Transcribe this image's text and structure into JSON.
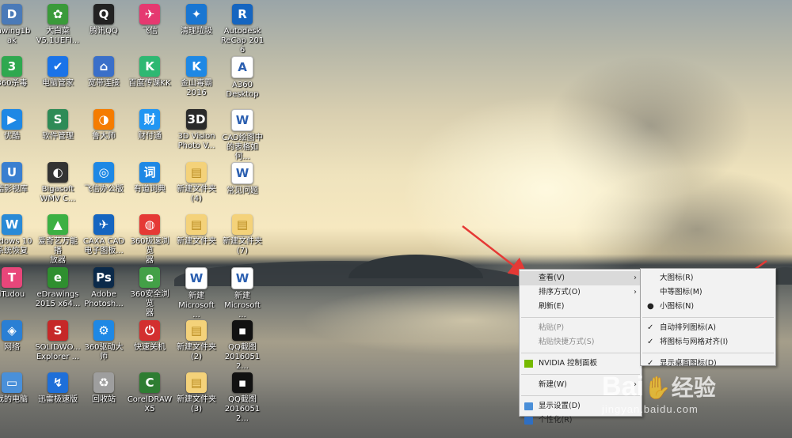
{
  "desktop": {
    "icons": [
      {
        "id": "i01",
        "label": "rawing1b\nak",
        "color": "#4a7ab8",
        "glyph": "D"
      },
      {
        "id": "i02",
        "label": "360杀毒",
        "color": "#2fa84f",
        "glyph": "3"
      },
      {
        "id": "i03",
        "label": "优酷",
        "color": "#1e88e5",
        "glyph": "▶"
      },
      {
        "id": "i04",
        "label": "酷影视库",
        "color": "#3a7fd0",
        "glyph": "U"
      },
      {
        "id": "i05",
        "label": "indows 10\n系统恢复",
        "color": "#2a8ad6",
        "glyph": "W"
      },
      {
        "id": "i06",
        "label": "iTudou",
        "color": "#e8467a",
        "glyph": "T"
      },
      {
        "id": "i07",
        "label": "网络",
        "color": "#2a7fd4",
        "glyph": "◈"
      },
      {
        "id": "i08",
        "label": "我的电脑",
        "color": "#4a90d9",
        "glyph": "▭"
      },
      {
        "id": "i09",
        "label": "大白菜\nV5.1UEFI...",
        "color": "#3a9a3a",
        "glyph": "✿"
      },
      {
        "id": "i10",
        "label": "电脑管家",
        "color": "#1a73e8",
        "glyph": "✔"
      },
      {
        "id": "i11",
        "label": "软件管理",
        "color": "#2e8b57",
        "glyph": "S"
      },
      {
        "id": "i12",
        "label": "Bigasoft\nWMV C...",
        "color": "#333333",
        "glyph": "◐"
      },
      {
        "id": "i13",
        "label": "爱奇艺万能播\n放器",
        "color": "#3cb043",
        "glyph": "▲"
      },
      {
        "id": "i14",
        "label": "eDrawings\n2015 x64...",
        "color": "#2f8f2f",
        "glyph": "e"
      },
      {
        "id": "i15",
        "label": "SOLIDWO...\nExplorer ...",
        "color": "#c62828",
        "glyph": "S"
      },
      {
        "id": "i16",
        "label": "迅雷极速版",
        "color": "#1e6fd9",
        "glyph": "↯"
      },
      {
        "id": "i17",
        "label": "腾讯QQ",
        "color": "#222222",
        "glyph": "Q"
      },
      {
        "id": "i18",
        "label": "宽带连接",
        "color": "#3a6fc9",
        "glyph": "⌂"
      },
      {
        "id": "i19",
        "label": "鲁大师",
        "color": "#f57c00",
        "glyph": "◑"
      },
      {
        "id": "i20",
        "label": "飞信办公版",
        "color": "#1e88e5",
        "glyph": "◎"
      },
      {
        "id": "i21",
        "label": "CAXA CAD\n电子图板...",
        "color": "#1565c0",
        "glyph": "✈"
      },
      {
        "id": "i22",
        "label": "Adobe\nPhotosh...",
        "color": "#0b2a4a",
        "glyph": "Ps"
      },
      {
        "id": "i23",
        "label": "360驱动大师",
        "color": "#1e88e5",
        "glyph": "⚙"
      },
      {
        "id": "i24",
        "label": "回收站",
        "color": "#9e9e9e",
        "glyph": "♻"
      },
      {
        "id": "i25",
        "label": "飞信",
        "color": "#e53970",
        "glyph": "✈"
      },
      {
        "id": "i26",
        "label": "百度传课KK",
        "color": "#2eb872",
        "glyph": "K"
      },
      {
        "id": "i27",
        "label": "财付通",
        "color": "#2196f3",
        "glyph": "财"
      },
      {
        "id": "i28",
        "label": "有道词典",
        "color": "#1e88e5",
        "glyph": "词"
      },
      {
        "id": "i29",
        "label": "360极速浏览\n器",
        "color": "#e53935",
        "glyph": "◍"
      },
      {
        "id": "i30",
        "label": "360安全浏览\n器",
        "color": "#43a047",
        "glyph": "e"
      },
      {
        "id": "i31",
        "label": "快速关机",
        "color": "#d32f2f",
        "glyph": "⏻"
      },
      {
        "id": "i32",
        "label": "CorelDRAW\nX5",
        "color": "#2e7d32",
        "glyph": "C"
      },
      {
        "id": "i33",
        "label": "清理垃圾",
        "color": "#1976d2",
        "glyph": "✦"
      },
      {
        "id": "i34",
        "label": "金山毒霸\n2016",
        "color": "#1e88e5",
        "glyph": "K"
      },
      {
        "id": "i35",
        "label": "3D Vision\nPhoto V...",
        "color": "#2a2a2a",
        "glyph": "3D"
      },
      {
        "id": "i36",
        "label": "新建文件夹\n(4)",
        "color": "#f4d27a",
        "glyph": "▤"
      },
      {
        "id": "i37",
        "label": "新建文件夹",
        "color": "#f4d27a",
        "glyph": "▤"
      },
      {
        "id": "i38",
        "label": "新建\nMicrosoft ...",
        "color": "#ffffff",
        "glyph": "W"
      },
      {
        "id": "i39",
        "label": "新建文件夹\n(2)",
        "color": "#f4d27a",
        "glyph": "▤"
      },
      {
        "id": "i40",
        "label": "新建文件夹\n(3)",
        "color": "#f4d27a",
        "glyph": "▤"
      },
      {
        "id": "i41",
        "label": "Autodesk\nReCap 2016",
        "color": "#1565c0",
        "glyph": "R"
      },
      {
        "id": "i42",
        "label": "A360\nDesktop",
        "color": "#ffffff",
        "glyph": "A"
      },
      {
        "id": "i43",
        "label": "CAD绘图中\n的表格如何...",
        "color": "#ffffff",
        "glyph": "W"
      },
      {
        "id": "i44",
        "label": "常见问题",
        "color": "#ffffff",
        "glyph": "W"
      },
      {
        "id": "i45",
        "label": "新建文件夹\n(7)",
        "color": "#f4d27a",
        "glyph": "▤"
      },
      {
        "id": "i46",
        "label": "新建\nMicrosoft ...",
        "color": "#ffffff",
        "glyph": "W"
      },
      {
        "id": "i47",
        "label": "QQ截图\n20160512...",
        "color": "#111111",
        "glyph": "▪"
      },
      {
        "id": "i48",
        "label": "QQ截图\n20160512...",
        "color": "#111111",
        "glyph": "▪"
      }
    ]
  },
  "context_menu": {
    "view": "查看(V)",
    "sort": "排序方式(O)",
    "refresh": "刷新(E)",
    "paste": "粘贴(P)",
    "paste_shortcut": "粘贴快捷方式(S)",
    "nvidia": "NVIDIA 控制面板",
    "new": "新建(W)",
    "display": "显示设置(D)",
    "personalize": "个性化(R)"
  },
  "submenu": {
    "large": "大图标(R)",
    "medium": "中等图标(M)",
    "small": "小图标(N)",
    "auto_arrange": "自动排列图标(A)",
    "align_grid": "将图标与网格对齐(I)",
    "show_icons": "显示桌面图标(D)"
  },
  "watermark": {
    "brand": "Bai",
    "brand2": "经验",
    "url": "jingyan.baidu.com"
  }
}
